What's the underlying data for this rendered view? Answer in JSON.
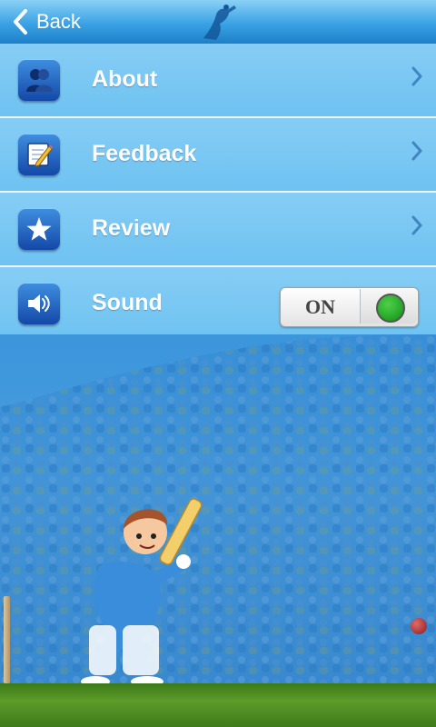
{
  "header": {
    "back_label": "Back",
    "logo_icon": "cricket-player-logo-icon"
  },
  "menu": {
    "items": [
      {
        "label": "About",
        "icon": "people-icon"
      },
      {
        "label": "Feedback",
        "icon": "notepad-pencil-icon"
      },
      {
        "label": "Review",
        "icon": "star-icon"
      },
      {
        "label": "Sound",
        "icon": "speaker-icon"
      }
    ]
  },
  "sound_toggle": {
    "label": "ON",
    "state": "on",
    "indicator_color": "#1aa31f"
  },
  "colors": {
    "header_accent": "#3aa2e4",
    "row_background": "#7cc8f3",
    "row_divider": "#e8f5fd",
    "icon_tile": "#1f5fc0"
  }
}
